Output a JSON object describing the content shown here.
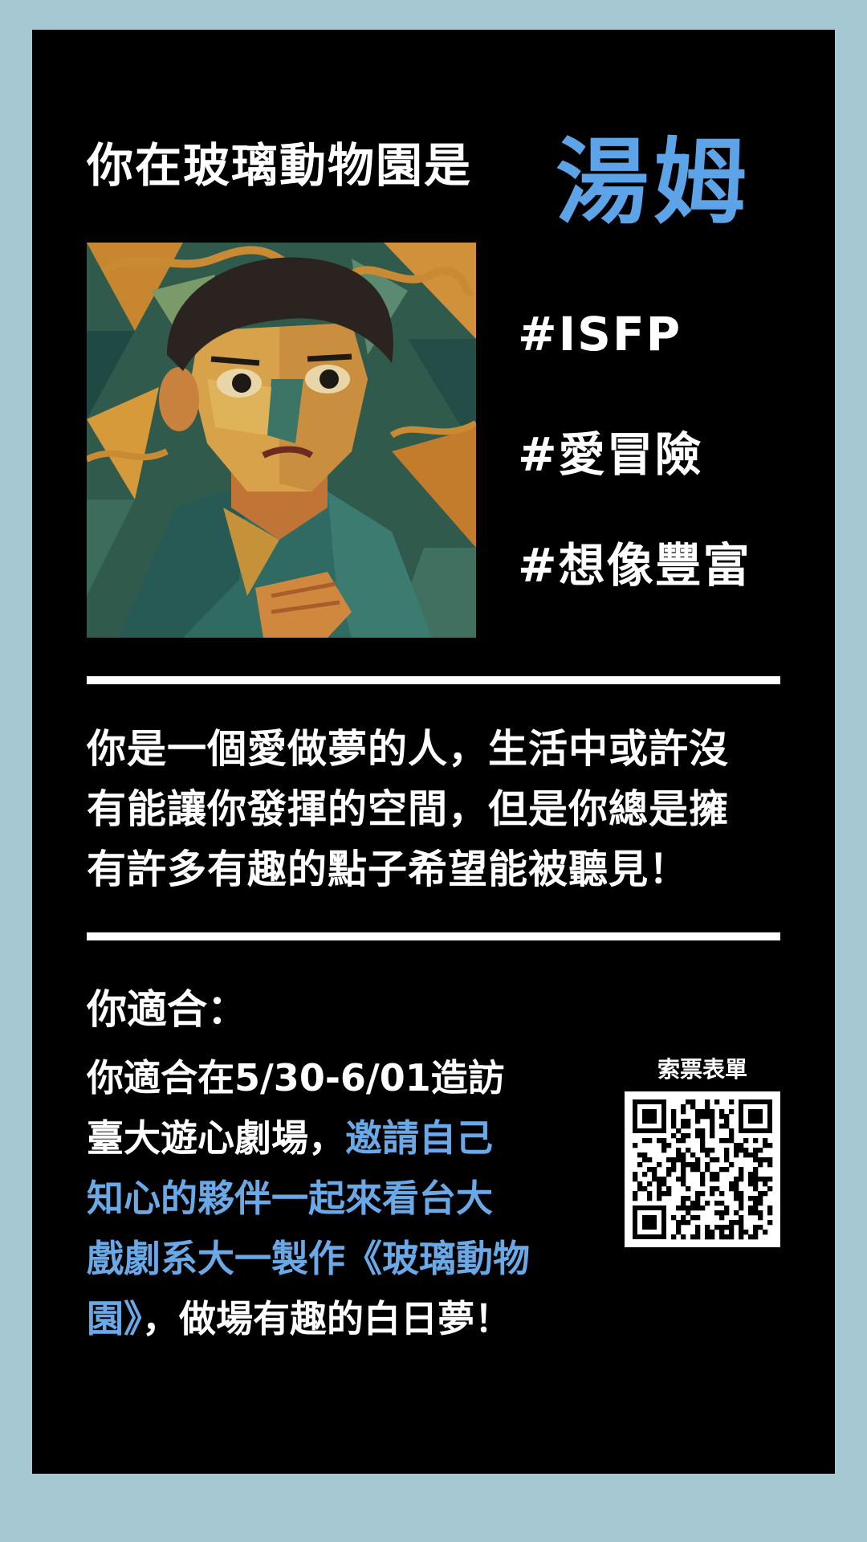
{
  "header": {
    "headline": "你在玻璃動物園是",
    "character_name": "湯姆"
  },
  "tags": [
    "#ISFP",
    "#愛冒險",
    "#想像豐富"
  ],
  "description": {
    "lines": [
      "你是一個愛做夢的人，生活中或許沒",
      "有能讓你發揮的空間，但是你總是擁",
      "有許多有趣的點子希望能被聽見！"
    ]
  },
  "fit": {
    "title": "你適合：",
    "line1": "你適合在5/30-6/01造訪",
    "line2_plain": "臺大遊心劇場，",
    "line2_highlight": "邀請自己",
    "line3_highlight": "知心的夥伴一起來看台大",
    "line4_highlight": "戲劇系大一製作《玻璃動物",
    "line5_highlight": "園》",
    "line5_plain": "，做場有趣的白日夢！"
  },
  "qr": {
    "label": "索票表單"
  },
  "colors": {
    "background": "#a6c8d3",
    "card": "#000000",
    "accent": "#5da3e8",
    "text": "#ffffff"
  },
  "icons": {
    "portrait": "cubist-portrait-illustration",
    "qr": "qr-code-icon"
  }
}
